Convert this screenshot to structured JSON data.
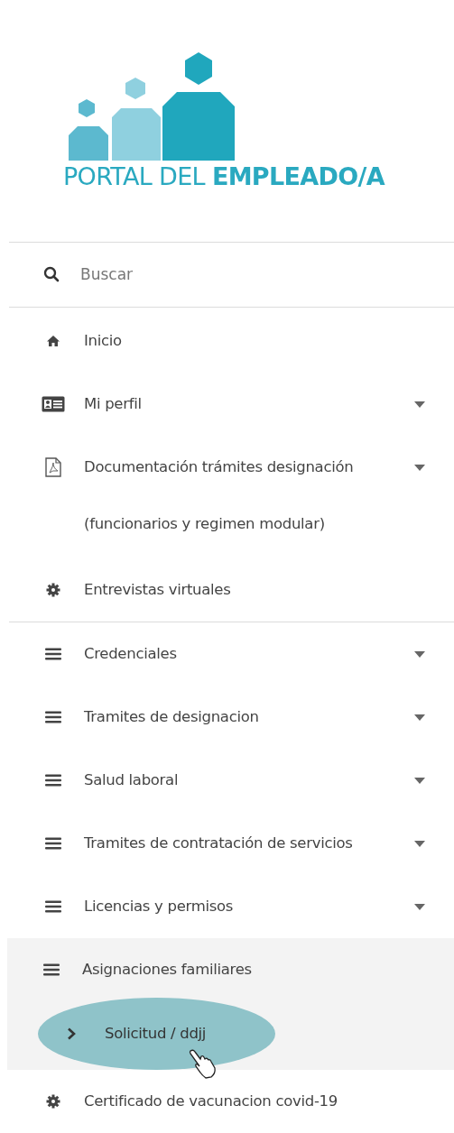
{
  "logo": {
    "text": "PORTAL DEL **EMPLEADO/A**"
  },
  "search": {
    "placeholder": "Buscar"
  },
  "sections": [
    {
      "items": [
        {
          "label": "Inicio",
          "kind": "home",
          "has_submenu": false
        },
        {
          "label": "Mi perfil",
          "kind": "profile",
          "has_submenu": true
        },
        {
          "label": "Documentación trámites designación",
          "label_line_2": "(funcionarios y regimen modular)",
          "kind": "document",
          "has_submenu": true
        },
        {
          "label": "Entrevistas virtuales",
          "kind": "settings",
          "has_submenu": false
        }
      ]
    },
    {
      "items": [
        {
          "label": "Credenciales",
          "kind": "category",
          "has_submenu": true
        },
        {
          "label": "Tramites de designacion",
          "kind": "category",
          "has_submenu": true
        },
        {
          "label": "Salud laboral",
          "kind": "category",
          "has_submenu": true
        },
        {
          "label": "Tramites de contratación de servicios",
          "kind": "category",
          "has_submenu": true
        },
        {
          "label": "Licencias y permisos",
          "kind": "category",
          "has_submenu": true
        },
        {
          "label": "Asignaciones familiares",
          "kind": "category",
          "has_submenu": false,
          "expanded": true,
          "children": [
            {
              "label": "Solicitud / ddjj",
              "selected": true
            }
          ]
        },
        {
          "label": "Certificado de vacunacion covid-19",
          "kind": "settings",
          "has_submenu": false
        }
      ]
    }
  ]
}
